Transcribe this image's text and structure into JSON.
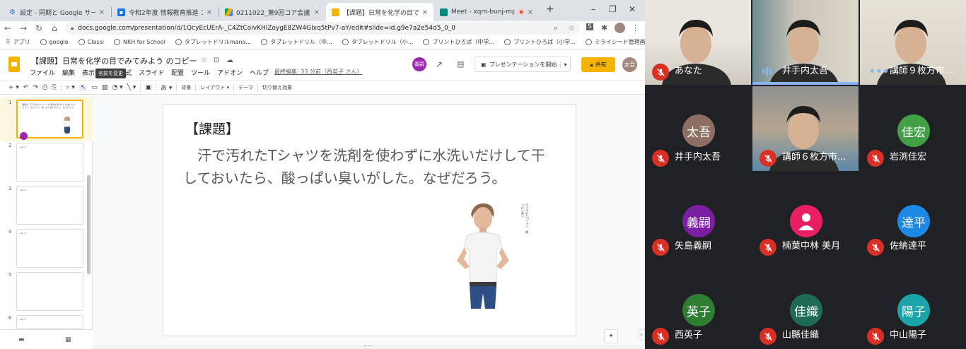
{
  "tabs": [
    {
      "label": "設定 - 同期と Google サービス",
      "fav": "gear-icon"
    },
    {
      "label": "令和2年度 情報教育推進 コア会",
      "fav": "contacts-icon"
    },
    {
      "label": "0211022_第9回コア会議資料 - G",
      "fav": "drive-icon"
    },
    {
      "label": "【課題】日常を化学の目でみてみよう",
      "fav": "slides-icon"
    },
    {
      "label": "Meet - xqm-bunj-mph",
      "fav": "meet-icon"
    }
  ],
  "address": "docs.google.com/presentation/d/1QcyEcUErA-_C4ZtCoivKHlZoygE8ZW4GIxq5tPv7-aY/edit#slide=id.g9e7a2e54d5_0_0",
  "bookmarks": [
    "アプリ",
    "google",
    "Classi",
    "NKH for School",
    "タブレットドリルmana...",
    "タブレットドリル（中...",
    "タブレットドリル（小...",
    "プリントひろば（中学...",
    "プリントひろば（小学...",
    "ミライシード管理画面"
  ],
  "doc": {
    "title": "【課題】日常を化学の目でみてみよう のコピー",
    "menus": [
      "ファイル",
      "編集",
      "表示",
      "挿入",
      "表示形式",
      "スライド",
      "配置",
      "ツール",
      "アドオン",
      "ヘルプ"
    ],
    "last_edit": "最終編集: 33 分前（西英子 さん）",
    "rename_tooltip": "名前を変更",
    "avatar1": "義嗣",
    "present_label": "プレゼンテーションを開始",
    "share_label": "共有",
    "avatar2": "太吾"
  },
  "toolbar": {
    "bg_label": "背景",
    "layout_label": "レイアウト",
    "theme_label": "テーマ",
    "transition_label": "切り替え効果"
  },
  "filmstrip": [
    {
      "num": "1",
      "text": "【課題】 汗で汚れたTシャツを洗剤を使わずに水洗いだけして干しておいたら、酸っぱい臭いがした。なぜだろう。"
    },
    {
      "num": "2",
      "text": "Lea 1"
    },
    {
      "num": "3",
      "text": "Lea 2"
    },
    {
      "num": "4",
      "text": "Lea 3"
    },
    {
      "num": "5",
      "text": ""
    },
    {
      "num": "6",
      "text": "Lea 4"
    }
  ],
  "slide": {
    "title": "【課題】",
    "body": "　汗で汚れたTシャツを洗剤を使わずに水洗いだけして干しておいたら、酸っぱい臭いがした。なぜだろう。",
    "vertical_note": "汗で汚れたTシャツ　酸っぱい臭い"
  },
  "meet": {
    "participants": [
      {
        "name": "あなた",
        "type": "video",
        "muted": true
      },
      {
        "name": "井手内太吾",
        "type": "video",
        "muted": false,
        "speaking": true
      },
      {
        "name": "講師９枚方市...",
        "type": "video",
        "muted": false
      },
      {
        "name": "井手内太吾",
        "initials": "太吾",
        "color": "#8d6e63",
        "muted": true
      },
      {
        "name": "講師６枚方市...",
        "type": "video",
        "muted": true
      },
      {
        "name": "岩渕佳宏",
        "initials": "佳宏",
        "color": "#43a047",
        "muted": true
      },
      {
        "name": "矢島義嗣",
        "initials": "義嗣",
        "color": "#7b1fa2",
        "muted": true
      },
      {
        "name": "楠葉中林 美月",
        "initials": "",
        "color": "#e91e63",
        "muted": true
      },
      {
        "name": "佐納達平",
        "initials": "達平",
        "color": "#1e88e5",
        "muted": true
      },
      {
        "name": "西英子",
        "initials": "英子",
        "color": "#2e7d32",
        "muted": true
      },
      {
        "name": "山縣佳織",
        "initials": "佳織",
        "color": "#1e6b55",
        "muted": true
      },
      {
        "name": "中山陽子",
        "initials": "陽子",
        "color": "#1aa3a8",
        "muted": true
      }
    ]
  }
}
